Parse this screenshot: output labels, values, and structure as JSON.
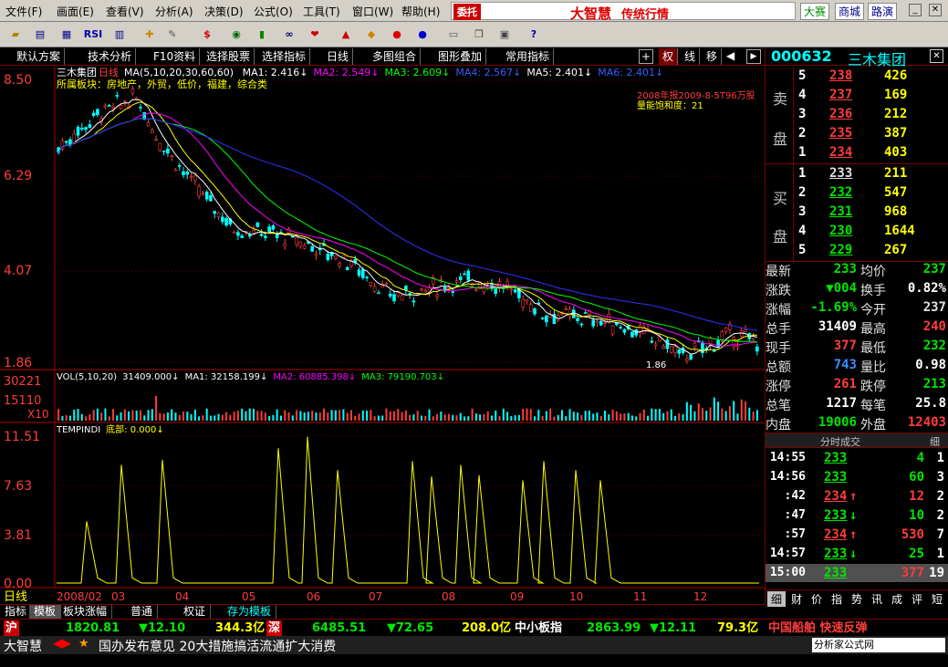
{
  "menu": [
    "文件(F)",
    "画面(E)",
    "查看(V)",
    "分析(A)",
    "决策(D)",
    "公式(O)",
    "工具(T)",
    "窗口(W)",
    "帮助(H)"
  ],
  "brand": {
    "tag": "委托",
    "name": "大智慧",
    "slogan": "传统行情",
    "btn1": "大赛",
    "btn2": "商城",
    "btn3": "路演"
  },
  "toolbar": {
    "rsi": "RSI"
  },
  "tabs": [
    "默认方案",
    "技术分析",
    "F10资料",
    "选择股票",
    "选择指标",
    "日线",
    "多图组合",
    "图形叠加",
    "常用指标"
  ],
  "tab_right": [
    "权",
    "线",
    "移"
  ],
  "header": {
    "stock": "三木集团",
    "period": "日线",
    "ma_label": "MA(5,10,20,30,60,60)",
    "ma1": "MA1: 2.416↓",
    "ma2": "MA2: 2.549↓",
    "ma3": "MA3: 2.609↓",
    "ma4": "MA4: 2.567↓",
    "ma5": "MA5: 2.401↓",
    "ma6": "MA6: 2.401↓",
    "sector": "所属板块：房地产，外贸，低价，福建，综合类",
    "note1": "2008年报2009-8-5T96万股",
    "note2": "量能饱和度：21",
    "low_label": "1.86"
  },
  "ytick_price": [
    "8.50",
    "6.29",
    "4.07",
    "1.86"
  ],
  "vol": {
    "label": "VOL(5,10,20)",
    "v": "31409.000↓",
    "ma1": "MA1: 32158.199↓",
    "ma2": "MA2: 60885.398↓",
    "ma3": "MA3: 79190.703↓",
    "yt": [
      "30221",
      "15110",
      "X10"
    ]
  },
  "ind": {
    "label": "TEMPINDI",
    "sub": "底部: 0.000↓",
    "yt": [
      "11.51",
      "7.63",
      "3.81",
      "0.00"
    ]
  },
  "xaxis": [
    "2008/02",
    "03",
    "04",
    "05",
    "06",
    "07",
    "08",
    "09",
    "10",
    "11",
    "12"
  ],
  "period_label": "日线",
  "code": "000632",
  "name": "三木集团",
  "sell": {
    "label1": "卖",
    "label2": "盘",
    "rows": [
      [
        "5",
        "238",
        "426"
      ],
      [
        "4",
        "237",
        "169"
      ],
      [
        "3",
        "236",
        "212"
      ],
      [
        "2",
        "235",
        "387"
      ],
      [
        "1",
        "234",
        "403"
      ]
    ]
  },
  "buy": {
    "label1": "买",
    "label2": "盘",
    "rows": [
      [
        "1",
        "233",
        "211"
      ],
      [
        "2",
        "232",
        "547"
      ],
      [
        "3",
        "231",
        "968"
      ],
      [
        "4",
        "230",
        "1644"
      ],
      [
        "5",
        "229",
        "267"
      ]
    ]
  },
  "stats": [
    [
      "最新",
      "233",
      "均价",
      "237"
    ],
    [
      "涨跌",
      "▼004",
      "换手",
      "0.82%"
    ],
    [
      "涨幅",
      "-1.69%",
      "今开",
      "237"
    ],
    [
      "总手",
      "31409",
      "最高",
      "240"
    ],
    [
      "现手",
      "377",
      "最低",
      "232"
    ],
    [
      "总额",
      "743",
      "量比",
      "0.98"
    ],
    [
      "涨停",
      "261",
      "跌停",
      "213"
    ],
    [
      "总笔",
      "1217",
      "每笔",
      "25.8"
    ],
    [
      "内盘",
      "19006",
      "外盘",
      "12403"
    ]
  ],
  "ticks_title": "分时成交",
  "ticks_btn": "细",
  "ticks": [
    [
      "14:55",
      "233",
      "",
      "4",
      "1"
    ],
    [
      "14:56",
      "233",
      "",
      "60",
      "3"
    ],
    [
      ":42",
      "234",
      "↑",
      "12",
      "2"
    ],
    [
      ":47",
      "233",
      "↓",
      "10",
      "2"
    ],
    [
      ":57",
      "234",
      "↑",
      "530",
      "7"
    ],
    [
      "14:57",
      "233",
      "↓",
      "25",
      "1"
    ],
    [
      "15:00",
      "233",
      "",
      "377",
      "19"
    ]
  ],
  "side_tabs": [
    "细",
    "财",
    "价",
    "指",
    "势",
    "讯",
    "成",
    "评",
    "短"
  ],
  "bottom_tabs": [
    "指标",
    "模板",
    "板块涨幅",
    "普通",
    "权证",
    "存为模板"
  ],
  "stk": {
    "sh": "沪",
    "sh_v": "1820.81",
    "sh_c": "▼12.10",
    "sh_a": "344.3亿",
    "sz": "深",
    "sz_v": "6485.51",
    "sz_c": "▼72.65",
    "sz_a": "208.0亿",
    "zx": "中小板指",
    "zx_v": "2863.99",
    "zx_c": "▼12.11",
    "zx_a": "79.3亿",
    "alert": "中国船舶 快速反弹"
  },
  "news": {
    "brand": "大智慧",
    "text": "国办发布意见 20大措施搞活流通扩大消费",
    "site": "分析家公式网",
    "url": "www.88gg.com"
  },
  "colors": {
    "up": "#ff3c3c",
    "down": "#00e600",
    "cyan": "#00ffff",
    "yellow": "#ffff00",
    "magenta": "#ff00ff",
    "blue": "#3030ff"
  }
}
